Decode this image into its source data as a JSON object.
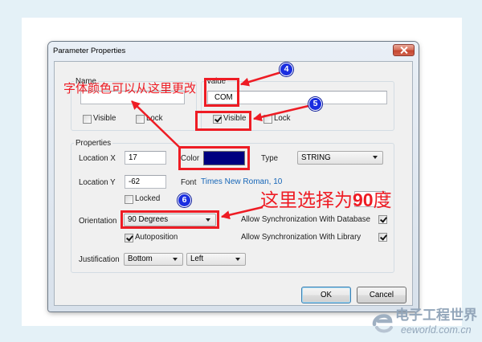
{
  "window": {
    "title": "Parameter Properties"
  },
  "icons": {
    "close": "close-icon",
    "dropdown": "chevron-down-icon",
    "checkmark": "checkmark-icon",
    "logo": "eeworld-logo-icon"
  },
  "name_group": {
    "label": "Name",
    "visible_label": "Visible",
    "visible_checked": false,
    "lock_label": "Lock",
    "lock_checked": false
  },
  "value_group": {
    "label": "Value",
    "value": "COM",
    "visible_label": "Visible",
    "visible_checked": true,
    "lock_label": "Lock",
    "lock_checked": false
  },
  "properties": {
    "label": "Properties",
    "location_x_label": "Location X",
    "location_x": "17",
    "location_y_label": "Location Y",
    "location_y": "-62",
    "color_label": "Color",
    "text_color": "#000080",
    "type_label": "Type",
    "type_value": "STRING",
    "font_label": "Font",
    "font_value": "Times New Roman, 10",
    "locked_label": "Locked",
    "locked_checked": false,
    "orientation_label": "Orientation",
    "orientation_value": "90 Degrees",
    "autoposition_label": "Autoposition",
    "autoposition_checked": true,
    "sync_database_label": "Allow Synchronization With Database",
    "sync_database_checked": true,
    "sync_library_label": "Allow Synchronization With Library",
    "sync_library_checked": true,
    "justification_label": "Justification",
    "justification_vertical": "Bottom",
    "justification_horizontal": "Left"
  },
  "buttons": {
    "ok": "OK",
    "cancel": "Cancel"
  },
  "annotations": {
    "color_note": "字体颜色可以从这里更改",
    "orientation_note": {
      "before": "这里选择为",
      "number": "90",
      "after": "度"
    },
    "badges": [
      "4",
      "5",
      "6"
    ]
  },
  "watermark": {
    "name": "电子工程世界",
    "url": "eeworld.com.cn"
  },
  "colors": {
    "annotation": "#ee1c24",
    "badge": "#1a2ee0",
    "link": "#1666b8"
  }
}
